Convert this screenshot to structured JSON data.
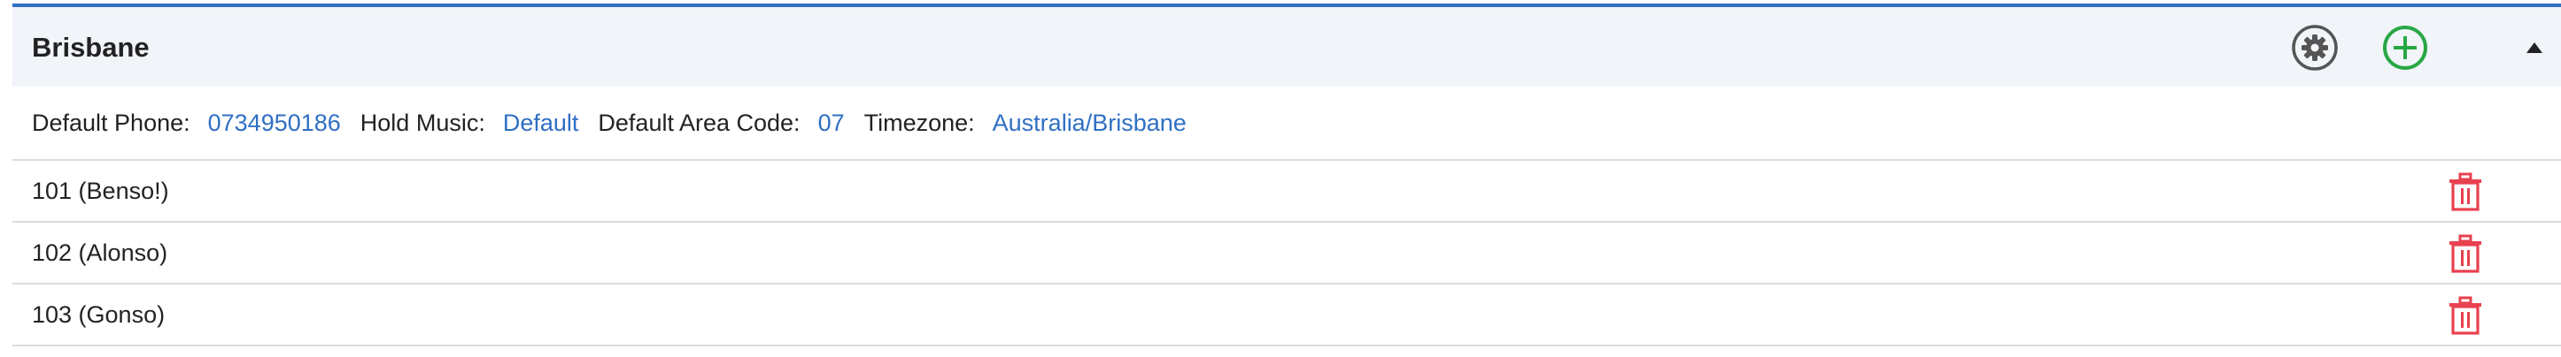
{
  "group": {
    "title": "Brisbane",
    "icons": {
      "settings": "gear-icon",
      "add": "plus-circle-icon",
      "collapse": "caret-up-icon"
    },
    "colors": {
      "accent": "#2f6fc4",
      "add": "#28a745",
      "delete": "#e8414f",
      "settings": "#555555"
    }
  },
  "info": {
    "default_phone_label": "Default Phone:",
    "default_phone": "0734950186",
    "hold_music_label": "Hold Music:",
    "hold_music": "Default",
    "area_code_label": "Default Area Code:",
    "area_code": "07",
    "timezone_label": "Timezone:",
    "timezone": "Australia/Brisbane"
  },
  "extensions": [
    {
      "label": "101 (Benso!)"
    },
    {
      "label": "102 (Alonso)"
    },
    {
      "label": "103 (Gonso)"
    }
  ]
}
